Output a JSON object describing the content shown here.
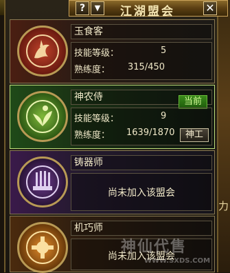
{
  "window": {
    "title": "江湖盟会",
    "help_label": "?",
    "scroll_label": "▼",
    "close_label": "✕"
  },
  "guilds": [
    {
      "name": "玉食客",
      "icon": "fire-dragon-icon",
      "level_label": "技能等级：",
      "level_value": "5",
      "proficiency_label": "熟练度：",
      "proficiency_value": "315/450"
    },
    {
      "name": "神农侍",
      "icon": "herb-leaf-icon",
      "current_badge": "当前",
      "level_label": "技能等级：",
      "level_value": "9",
      "proficiency_label": "熟练度：",
      "proficiency_value": "1639/1870",
      "action_button": "神工"
    },
    {
      "name": "铸器师",
      "icon": "weapon-rack-icon",
      "status": "尚未加入该盟会"
    },
    {
      "name": "机巧师",
      "icon": "mechanism-gear-icon",
      "status": "尚未加入该盟会"
    }
  ],
  "side_text": "力",
  "watermark": {
    "text": "神仙代售",
    "url": "WWW.SXDS.COM"
  }
}
